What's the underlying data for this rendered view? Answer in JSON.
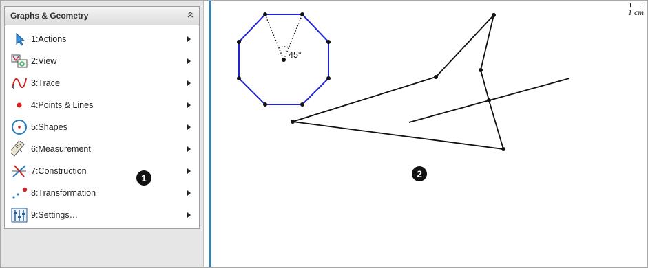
{
  "app": {
    "menu_title": "Graphs & Geometry",
    "collapse_icon": "double-chevron-up-icon"
  },
  "menu": {
    "items": [
      {
        "key": "1",
        "label": ":Actions",
        "icon": "pointer-arrow-icon"
      },
      {
        "key": "2",
        "label": ":View",
        "icon": "view-icon"
      },
      {
        "key": "3",
        "label": ":Trace",
        "icon": "trace-icon"
      },
      {
        "key": "4",
        "label": ":Points & Lines",
        "icon": "point-icon"
      },
      {
        "key": "5",
        "label": ":Shapes",
        "icon": "circle-shape-icon"
      },
      {
        "key": "6",
        "label": ":Measurement",
        "icon": "ruler-icon"
      },
      {
        "key": "7",
        "label": ":Construction",
        "icon": "construction-icon"
      },
      {
        "key": "8",
        "label": ":Transformation",
        "icon": "transformation-icon"
      },
      {
        "key": "9",
        "label": ":Settings…",
        "icon": "settings-sliders-icon"
      }
    ]
  },
  "callouts": {
    "one": "1",
    "two": "2"
  },
  "canvas": {
    "scale_label": "1 cm",
    "angle_label": "45°"
  },
  "colors": {
    "polygon": "#1f25d6",
    "divider": "#3d7fa8",
    "callout": "#111111"
  }
}
